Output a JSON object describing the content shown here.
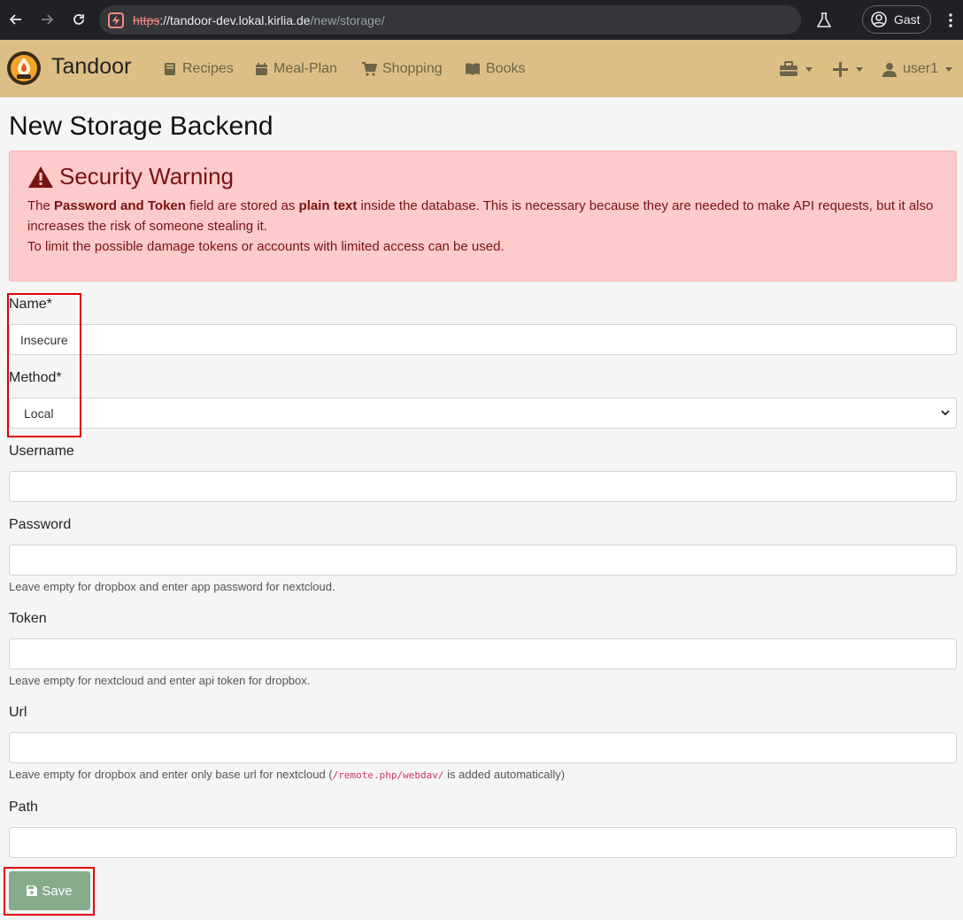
{
  "browser": {
    "url_scheme": "https",
    "url_host": "://tandoor-dev.lokal.kirlia.de",
    "url_path": "/new/storage/",
    "profile_name": "Gast"
  },
  "navbar": {
    "brand": "Tandoor",
    "items": [
      {
        "label": "Recipes",
        "icon": "book-icon"
      },
      {
        "label": "Meal-Plan",
        "icon": "calendar-icon"
      },
      {
        "label": "Shopping",
        "icon": "cart-icon"
      },
      {
        "label": "Books",
        "icon": "open-book-icon"
      }
    ],
    "user": "user1",
    "background_color": "#ddbf86"
  },
  "page": {
    "title": "New Storage Backend"
  },
  "alert": {
    "title": "Security Warning",
    "line1_pre": "The ",
    "line1_bold1": "Password and Token",
    "line1_mid": " field are stored as ",
    "line1_bold2": "plain text",
    "line1_post": " inside the database. This is necessary because they are needed to make API requests, but it also increases the risk of someone stealing it.",
    "line2": "To limit the possible damage tokens or accounts with limited access can be used.",
    "background_color": "#fdcbcb"
  },
  "form": {
    "name_label": "Name*",
    "name_value": "Insecure",
    "method_label": "Method*",
    "method_value": "Local",
    "username_label": "Username",
    "username_value": "",
    "password_label": "Password",
    "password_value": "",
    "password_help": "Leave empty for dropbox and enter app password for nextcloud.",
    "token_label": "Token",
    "token_value": "",
    "token_help": "Leave empty for nextcloud and enter api token for dropbox.",
    "url_label": "Url",
    "url_value": "",
    "url_help_pre": "Leave empty for dropbox and enter only base url for nextcloud (",
    "url_help_code": "/remote.php/webdav/",
    "url_help_post": " is added automatically)",
    "path_label": "Path",
    "path_value": "",
    "save_label": "Save",
    "save_color": "#86ab8b"
  }
}
